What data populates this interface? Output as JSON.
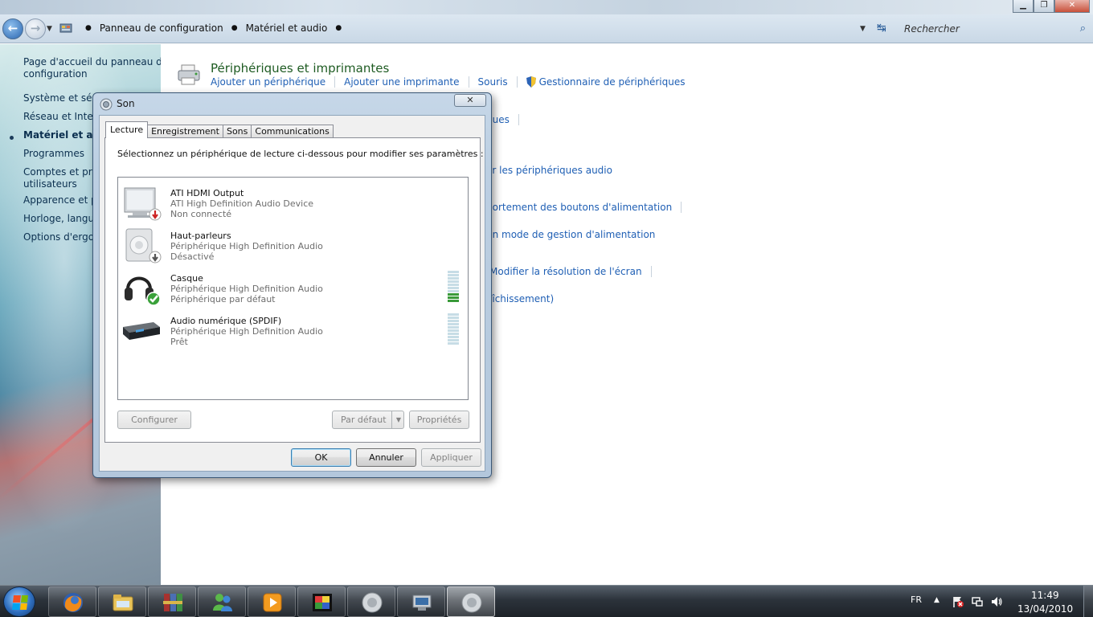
{
  "addressbar": {
    "breadcrumb": [
      "Panneau de configuration",
      "Matériel et audio"
    ],
    "search_placeholder": "Rechercher"
  },
  "sidebar": {
    "items": [
      {
        "label_line1": "Page d'accueil du panneau de",
        "label_line2": "configuration"
      },
      {
        "label": "Système et sécu"
      },
      {
        "label": "Réseau et Interne"
      },
      {
        "label": "Matériel et audi",
        "current": true
      },
      {
        "label": "Programmes"
      },
      {
        "label_line1": "Comptes et prot",
        "label_line2": "utilisateurs"
      },
      {
        "label": "Apparence et pe"
      },
      {
        "label": "Horloge, langue"
      },
      {
        "label": "Options d'ergon"
      }
    ]
  },
  "main": {
    "devices": {
      "heading": "Périphériques et imprimantes",
      "links": [
        "Ajouter un périphérique",
        "Ajouter une imprimante",
        "Souris",
        "Gestionnaire de périphériques"
      ]
    },
    "partial_links": [
      "ques",
      "er les périphériques audio",
      "portement des boutons d'alimentation",
      "un mode de gestion d'alimentation",
      "Modifier la résolution de l'écran",
      "aîchissement)"
    ]
  },
  "dialog": {
    "title": "Son",
    "close_label": "✕",
    "tabs": [
      "Lecture",
      "Enregistrement",
      "Sons",
      "Communications"
    ],
    "active_tab": "Lecture",
    "instructions": "Sélectionnez un périphérique de lecture ci-dessous pour modifier ses paramètres :",
    "devices": [
      {
        "name": "ATI HDMI Output",
        "description": "ATI High Definition Audio Device",
        "status": "Non connecté",
        "icon": "hdmi-monitor-icon"
      },
      {
        "name": "Haut-parleurs",
        "description": "Périphérique High Definition Audio",
        "status": "Désactivé",
        "icon": "speaker-icon"
      },
      {
        "name": "Casque",
        "description": "Périphérique High Definition Audio",
        "status": "Périphérique par défaut",
        "icon": "headphones-icon",
        "level_fraction": 0.3
      },
      {
        "name": "Audio numérique (SPDIF)",
        "description": "Périphérique High Definition Audio",
        "status": "Prêt",
        "icon": "spdif-device-icon",
        "level_fraction": 0
      }
    ],
    "buttons": {
      "configure": "Configurer",
      "set_default": "Par défaut",
      "properties": "Propriétés",
      "ok": "OK",
      "cancel": "Annuler",
      "apply": "Appliquer"
    }
  },
  "taskbar": {
    "language": "FR",
    "time": "11:49",
    "date": "13/04/2010",
    "pinned": [
      "firefox-icon",
      "explorer-icon",
      "winrar-icon",
      "messenger-icon",
      "media-player-icon",
      "photo-viewer-icon",
      "sound-icon",
      "control-panel-icon",
      "sound-icon"
    ]
  },
  "colors": {
    "link_blue": "#1f5fb4",
    "heading_green": "#1e5b22",
    "meter_on": "#3a9a3a"
  }
}
